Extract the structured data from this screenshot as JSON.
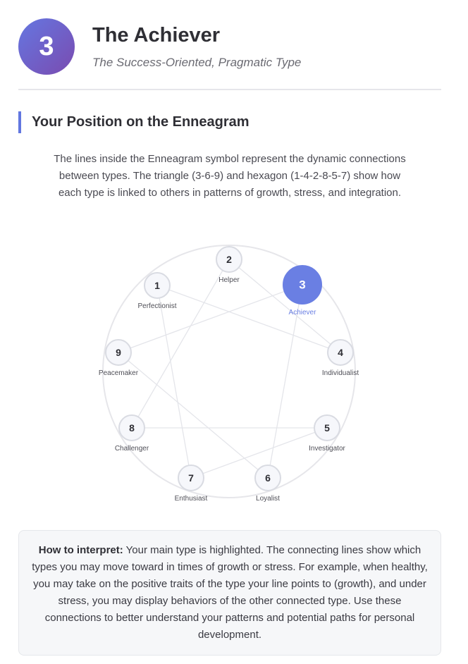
{
  "header": {
    "type_number": "3",
    "title": "The Achiever",
    "subtitle": "The Success-Oriented, Pragmatic Type"
  },
  "section": {
    "heading": "Your Position on the Enneagram",
    "intro": "The lines inside the Enneagram symbol represent the dynamic connections between types. The triangle (3-6-9) and hexagon (1-4-2-8-5-7) show how each type is linked to others in patterns of growth, stress, and integration."
  },
  "enneagram": {
    "active_type": "3",
    "accent_color": "#6a7fe3",
    "types": [
      {
        "num": "1",
        "label": "Perfectionist"
      },
      {
        "num": "2",
        "label": "Helper"
      },
      {
        "num": "3",
        "label": "Achiever"
      },
      {
        "num": "4",
        "label": "Individualist"
      },
      {
        "num": "5",
        "label": "Investigator"
      },
      {
        "num": "6",
        "label": "Loyalist"
      },
      {
        "num": "7",
        "label": "Enthusiast"
      },
      {
        "num": "8",
        "label": "Challenger"
      },
      {
        "num": "9",
        "label": "Peacemaker"
      }
    ],
    "connections": [
      [
        "3",
        "6"
      ],
      [
        "6",
        "9"
      ],
      [
        "9",
        "3"
      ],
      [
        "1",
        "4"
      ],
      [
        "4",
        "2"
      ],
      [
        "2",
        "8"
      ],
      [
        "8",
        "5"
      ],
      [
        "5",
        "7"
      ],
      [
        "7",
        "1"
      ]
    ]
  },
  "interpret": {
    "label": "How to interpret:",
    "text": " Your main type is highlighted. The connecting lines show which types you may move toward in times of growth or stress. For example, when healthy, you may take on the positive traits of the type your line points to (growth), and under stress, you may display behaviors of the other connected type. Use these connections to better understand your patterns and potential paths for personal development."
  }
}
